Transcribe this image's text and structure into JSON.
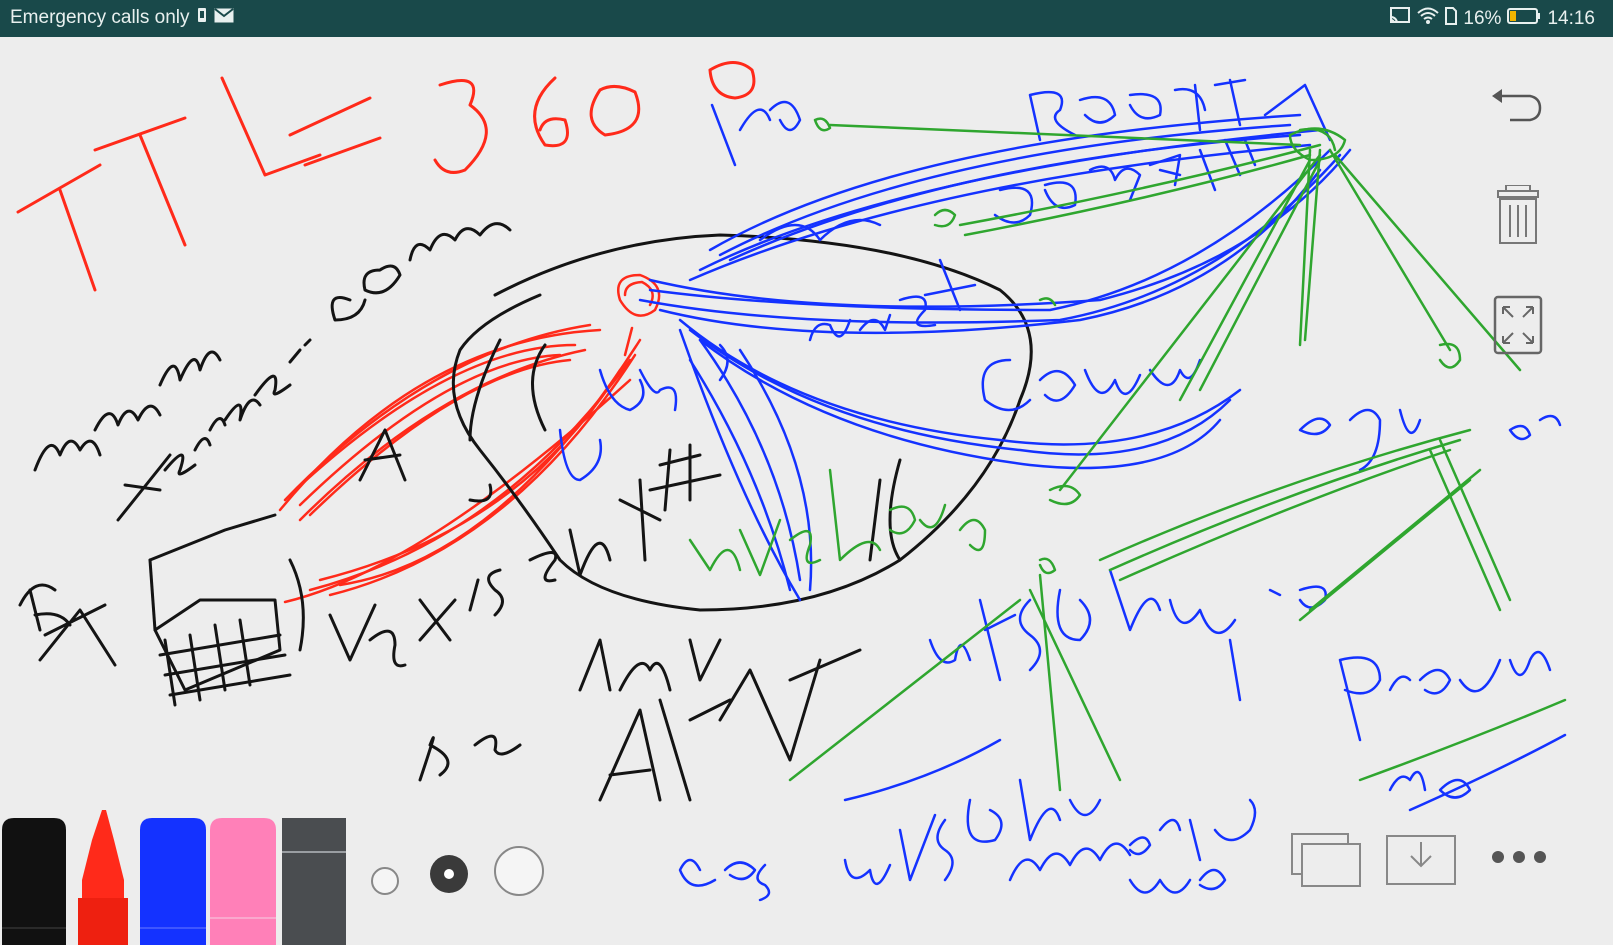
{
  "status_bar": {
    "carrier_text": "Emergency calls only",
    "battery_percent": "16%",
    "time": "14:16",
    "icons": [
      "sim-icon",
      "mail-icon",
      "cast-icon",
      "wifi-icon",
      "sim-card-icon",
      "battery-icon"
    ]
  },
  "canvas": {
    "right_tools": [
      "undo-icon",
      "trash-icon",
      "fullscreen-icon"
    ],
    "bottom_tools": [
      "copy-pages-icon",
      "download-icon",
      "more-icon"
    ],
    "pens": [
      {
        "name": "black",
        "color": "#111111"
      },
      {
        "name": "red",
        "color": "#ff2a1a"
      },
      {
        "name": "blue",
        "color": "#1432ff"
      },
      {
        "name": "pink",
        "color": "#ff80b8"
      },
      {
        "name": "eraser",
        "color": "#4a4d50"
      }
    ],
    "selected_pen": "red",
    "stroke_sizes": [
      "small",
      "medium",
      "large"
    ],
    "selected_size": "medium"
  }
}
